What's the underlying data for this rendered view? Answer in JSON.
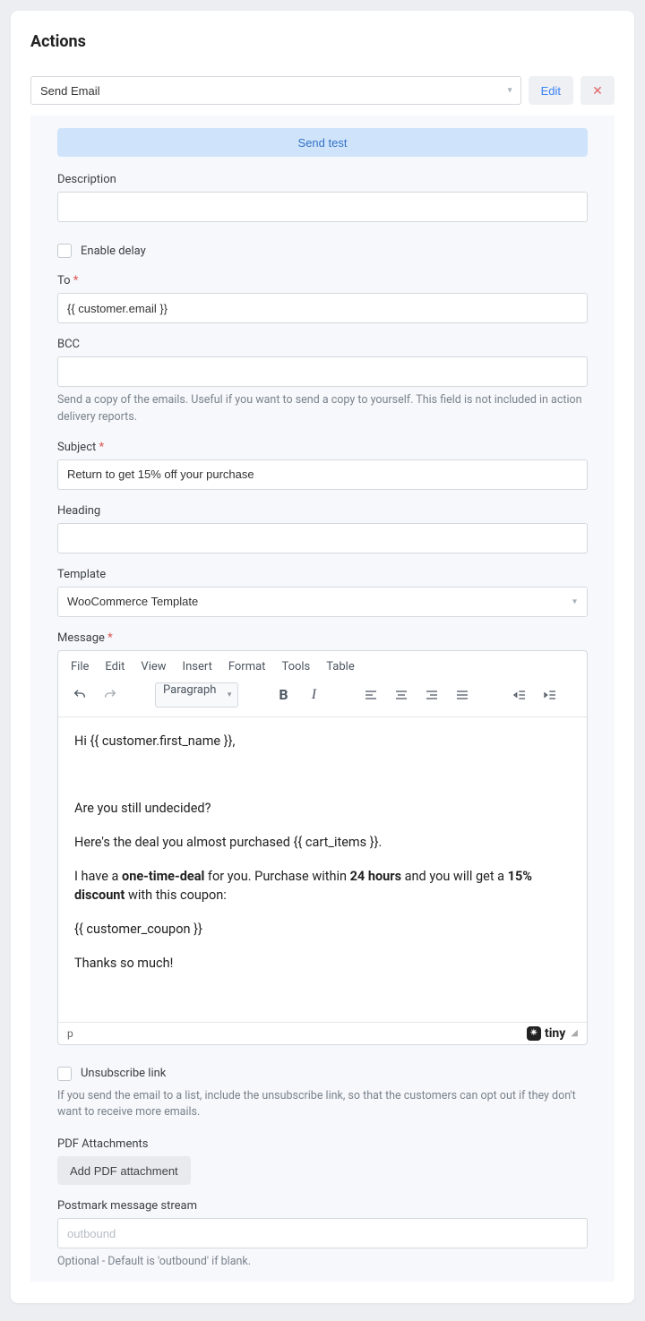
{
  "title": "Actions",
  "action_select": {
    "value": "Send Email"
  },
  "buttons": {
    "edit": "Edit",
    "send_test": "Send test",
    "add_pdf": "Add PDF attachment"
  },
  "fields": {
    "description": {
      "label": "Description",
      "value": ""
    },
    "enable_delay": {
      "label": "Enable delay"
    },
    "to": {
      "label": "To",
      "value": "{{ customer.email }}"
    },
    "bcc": {
      "label": "BCC",
      "value": "",
      "help": "Send a copy of the emails. Useful if you want to send a copy to yourself. This field is not included in action delivery reports."
    },
    "subject": {
      "label": "Subject",
      "value": "Return to get 15% off your purchase"
    },
    "heading": {
      "label": "Heading",
      "value": ""
    },
    "template": {
      "label": "Template",
      "value": "WooCommerce Template"
    },
    "message": {
      "label": "Message"
    },
    "unsubscribe": {
      "label": "Unsubscribe link",
      "help": "If you send the email to a list, include the unsubscribe link, so that the customers can opt out if they don't want to receive more emails."
    },
    "pdf": {
      "label": "PDF Attachments"
    },
    "postmark": {
      "label": "Postmark message stream",
      "placeholder": "outbound",
      "help": "Optional - Default is 'outbound' if blank."
    }
  },
  "editor": {
    "menus": [
      "File",
      "Edit",
      "View",
      "Insert",
      "Format",
      "Tools",
      "Table"
    ],
    "format_select": "Paragraph",
    "path": "p",
    "brand": "tiny",
    "body": {
      "l1": "Hi {{ customer.first_name }},",
      "l2": "Are you still undecided?",
      "l3": "Here's the deal you almost purchased {{ cart_items }}.",
      "l4a": "I have a ",
      "l4b": "one-time-deal",
      "l4c": " for you. Purchase within ",
      "l4d": "24 hours",
      "l4e": " and you will get a ",
      "l4f": "15% discount",
      "l4g": " with this coupon:",
      "l5": "{{ customer_coupon }}",
      "l6": "Thanks so much!"
    }
  }
}
